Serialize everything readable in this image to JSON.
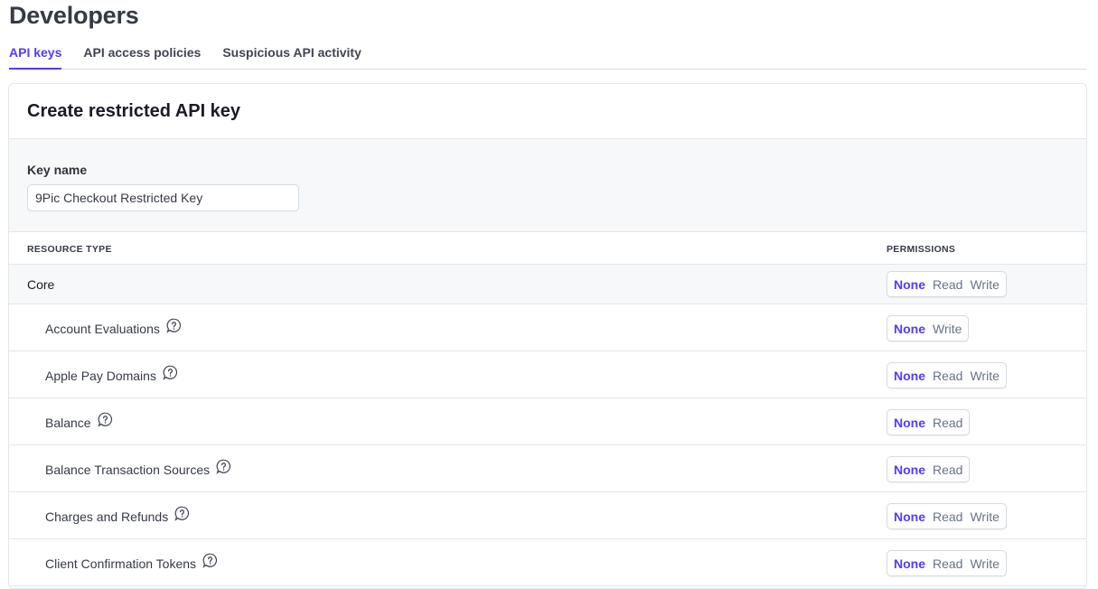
{
  "header": {
    "title": "Developers"
  },
  "tabs": [
    {
      "label": "API keys",
      "active": true
    },
    {
      "label": "API access policies",
      "active": false
    },
    {
      "label": "Suspicious API activity",
      "active": false
    }
  ],
  "card": {
    "title": "Create restricted API key",
    "key_name": {
      "label": "Key name",
      "value": "9Pic Checkout Restricted Key"
    },
    "columns": {
      "resource": "RESOURCE TYPE",
      "permissions": "PERMISSIONS"
    },
    "group": {
      "label": "Core",
      "options": [
        "None",
        "Read",
        "Write"
      ],
      "selected": "None"
    },
    "resources": [
      {
        "label": "Account Evaluations",
        "options": [
          "None",
          "Write"
        ],
        "selected": "None"
      },
      {
        "label": "Apple Pay Domains",
        "options": [
          "None",
          "Read",
          "Write"
        ],
        "selected": "None"
      },
      {
        "label": "Balance",
        "options": [
          "None",
          "Read"
        ],
        "selected": "None"
      },
      {
        "label": "Balance Transaction Sources",
        "options": [
          "None",
          "Read"
        ],
        "selected": "None"
      },
      {
        "label": "Charges and Refunds",
        "options": [
          "None",
          "Read",
          "Write"
        ],
        "selected": "None"
      },
      {
        "label": "Client Confirmation Tokens",
        "options": [
          "None",
          "Read",
          "Write"
        ],
        "selected": "None"
      }
    ]
  },
  "colors": {
    "accent": "#533afd",
    "muted_bg": "#f6f8fa",
    "border": "#e3e6eb"
  },
  "icons": {
    "help": "question-circle-icon"
  }
}
